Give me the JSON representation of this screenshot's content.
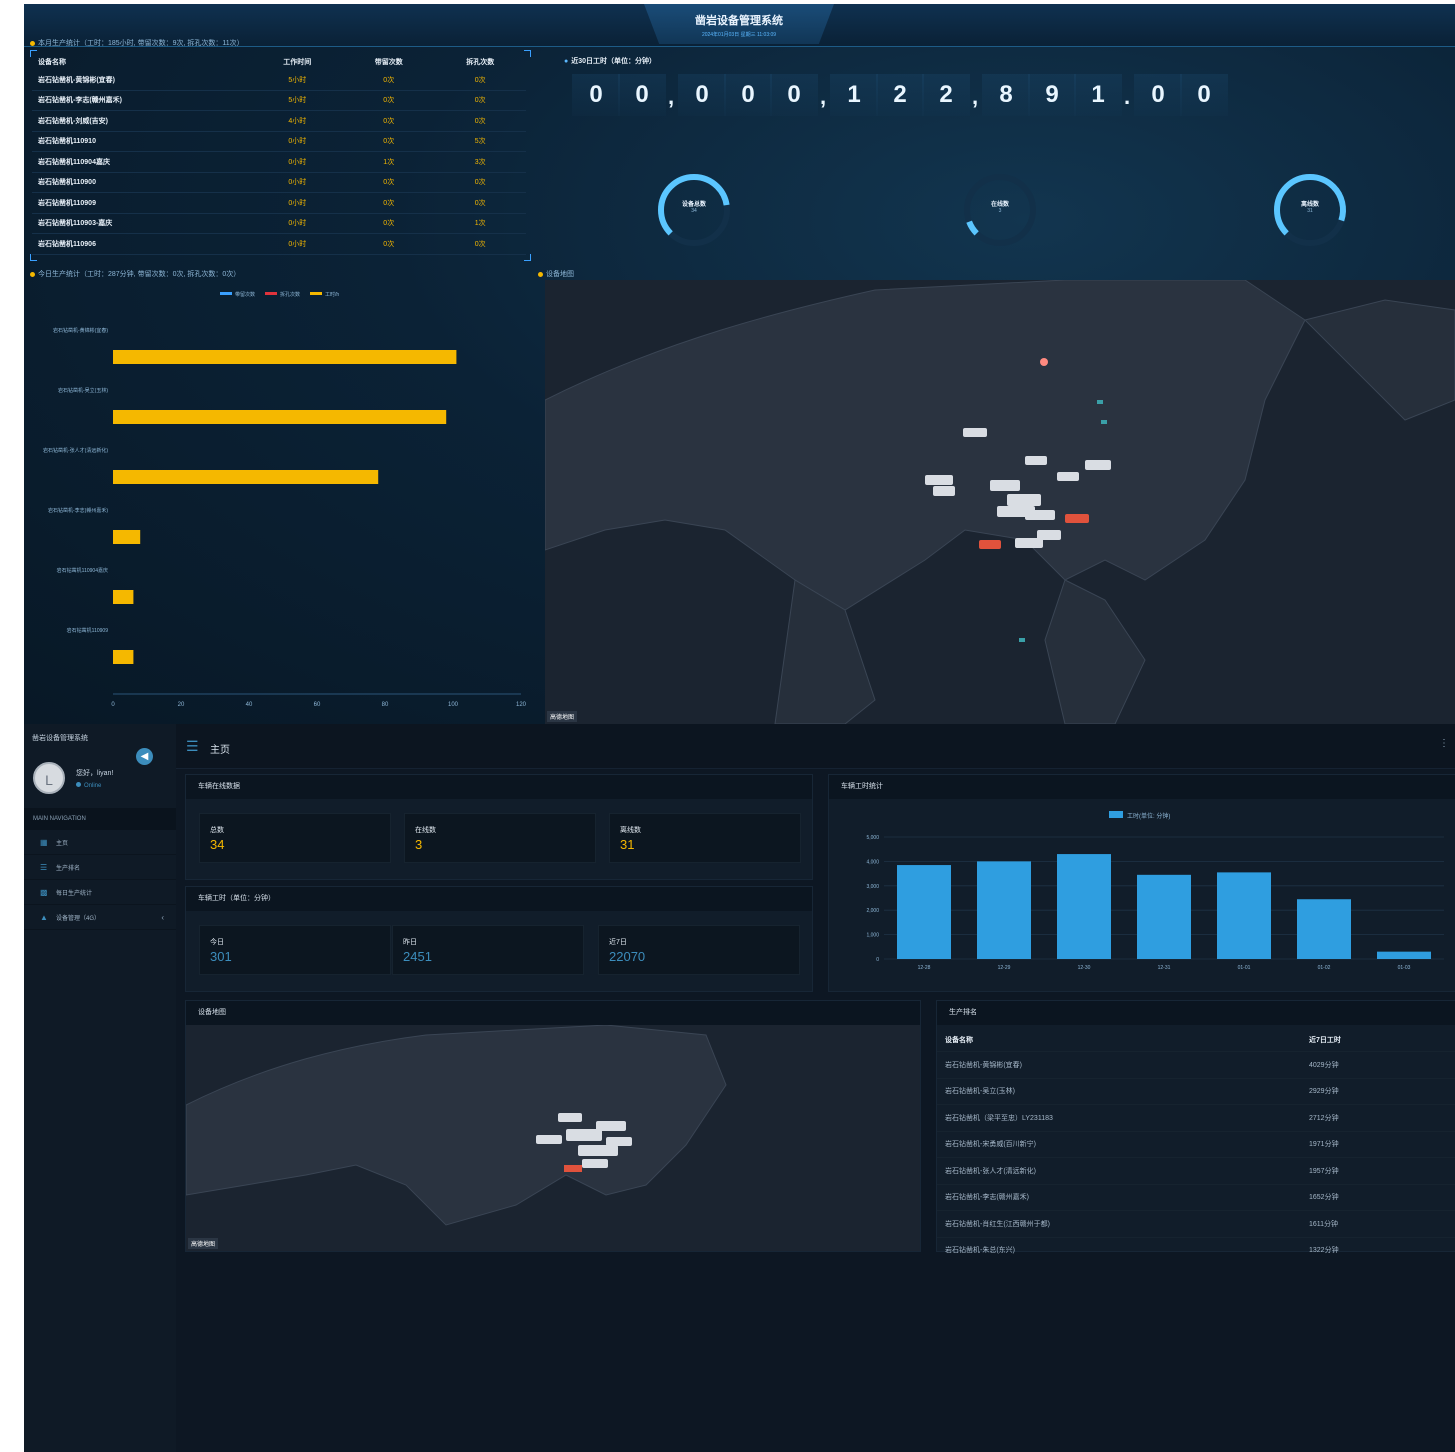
{
  "big_screen": {
    "title": "凿岩设备管理系统",
    "subtitle": "2024年01月03日 星期三 11:03:09",
    "monthly_title": "本月生产统计（工时：185小时, 带留次数：9次, 拆孔次数：11次）",
    "table_headers": [
      "设备名称",
      "工作时间",
      "带留次数",
      "拆孔次数"
    ],
    "table_rows": [
      [
        "岩石钻凿机-黄锦彬(宜春)",
        "5小时",
        "0次",
        "0次"
      ],
      [
        "岩石钻凿机-李志(赣州嘉禾)",
        "5小时",
        "0次",
        "0次"
      ],
      [
        "岩石钻凿机-刘威(吉安)",
        "4小时",
        "0次",
        "0次"
      ],
      [
        "岩石钻凿机110910",
        "0小时",
        "0次",
        "5次"
      ],
      [
        "岩石钻凿机110904嘉庆",
        "0小时",
        "1次",
        "3次"
      ],
      [
        "岩石钻凿机110900",
        "0小时",
        "0次",
        "0次"
      ],
      [
        "岩石钻凿机110909",
        "0小时",
        "0次",
        "0次"
      ],
      [
        "岩石钻凿机110903-嘉庆",
        "0小时",
        "0次",
        "1次"
      ],
      [
        "岩石钻凿机110906",
        "0小时",
        "0次",
        "0次"
      ]
    ],
    "worktime_title": "近30日工时（单位：分钟）",
    "odometer": [
      "0",
      "0",
      ",",
      "0",
      "0",
      "0",
      ",",
      "1",
      "2",
      "2",
      ",",
      "8",
      "9",
      "1",
      ".",
      "0",
      "0"
    ],
    "gauges": [
      {
        "label": "设备总数",
        "value": "34",
        "fraction": 0.8
      },
      {
        "label": "在线数",
        "value": "3",
        "fraction": 0.09
      },
      {
        "label": "离线数",
        "value": "31",
        "fraction": 0.9
      }
    ],
    "today_title": "今日生产统计（工时：287分钟, 带留次数：0次, 拆孔次数：0次）",
    "map_title": "设备地图",
    "map_logo": "高德地图",
    "colors": {
      "accent": "#f5b800",
      "primary": "#3aa0ff"
    }
  },
  "chart_data": [
    {
      "type": "bar",
      "orientation": "horizontal",
      "legend": [
        "带留次数",
        "拆孔次数",
        "工时/h"
      ],
      "legend_colors": [
        "#3aa0ff",
        "#e0333c",
        "#f5b800"
      ],
      "legend_position": "top-center",
      "categories": [
        "岩石钻凿机-黄锦彬(宜春)",
        "岩石钻凿机-吴立(玉林)",
        "岩石钻凿机-张人才(清远新化)",
        "岩石钻凿机-李志(赣州嘉禾)",
        "岩石钻凿机110904嘉庆",
        "岩石钻凿机110909"
      ],
      "series": [
        {
          "name": "工时/h",
          "values": [
            101,
            98,
            78,
            8,
            6,
            6
          ]
        }
      ],
      "x_ticks": [
        0,
        20,
        40,
        60,
        80,
        100,
        120
      ],
      "xlim": [
        0,
        120
      ]
    },
    {
      "type": "bar",
      "title": "车辆工时统计",
      "legend": [
        "工时(单位: 分钟)"
      ],
      "legend_position": "top-center",
      "categories": [
        "12-28",
        "12-29",
        "12-30",
        "12-31",
        "01-01",
        "01-02",
        "01-03"
      ],
      "series": [
        {
          "name": "工时(单位: 分钟)",
          "values": [
            3850,
            4000,
            4300,
            3450,
            3550,
            2450,
            301
          ]
        }
      ],
      "y_ticks": [
        "0",
        "1,000",
        "2,000",
        "3,000",
        "4,000",
        "5,000"
      ],
      "ylim": [
        0,
        5000
      ],
      "color": "#2f9ee0"
    }
  ],
  "sidebar": {
    "brand": "凿岩设备管理系统",
    "user_initial": "L",
    "user_name": "您好，liyan!",
    "user_status": "Online",
    "nav_header": "MAIN NAVIGATION",
    "items": [
      {
        "label": "主页",
        "icon": "dashboard-icon"
      },
      {
        "label": "生产排名",
        "icon": "list-icon"
      },
      {
        "label": "每日生产统计",
        "icon": "calendar-icon"
      },
      {
        "label": "设备管理（4G）",
        "icon": "car-icon"
      }
    ]
  },
  "topbar": {
    "title": "主页"
  },
  "online_box": {
    "title": "车辆在线数据",
    "stats": [
      {
        "label": "总数",
        "value": "34"
      },
      {
        "label": "在线数",
        "value": "3"
      },
      {
        "label": "离线数",
        "value": "31"
      }
    ]
  },
  "worktime_box": {
    "title": "车辆工时（单位：分钟）",
    "stats": [
      {
        "label": "今日",
        "value": "301"
      },
      {
        "label": "昨日",
        "value": "2451"
      },
      {
        "label": "近7日",
        "value": "22070"
      }
    ]
  },
  "chart_box": {
    "title": "车辆工时统计"
  },
  "map_box": {
    "title": "设备地图",
    "logo": "高德地图"
  },
  "ranking": {
    "title": "生产排名",
    "headers": [
      "设备名称",
      "近7日工时"
    ],
    "rows": [
      [
        "岩石钻凿机-黄锦彬(宜春)",
        "4029分钟"
      ],
      [
        "岩石钻凿机-吴立(玉林)",
        "2929分钟"
      ],
      [
        "岩石钻凿机（梁平至忠）LY231183",
        "2712分钟"
      ],
      [
        "岩石钻凿机-宋勇威(百川新宁)",
        "1971分钟"
      ],
      [
        "岩石钻凿机-张人才(清远新化)",
        "1957分钟"
      ],
      [
        "岩石钻凿机-李志(赣州嘉禾)",
        "1652分钟"
      ],
      [
        "岩石钻凿机-肖红生(江西赣州于都)",
        "1611分钟"
      ],
      [
        "岩石钻凿机-朱总(东兴)",
        "1322分钟"
      ]
    ]
  }
}
